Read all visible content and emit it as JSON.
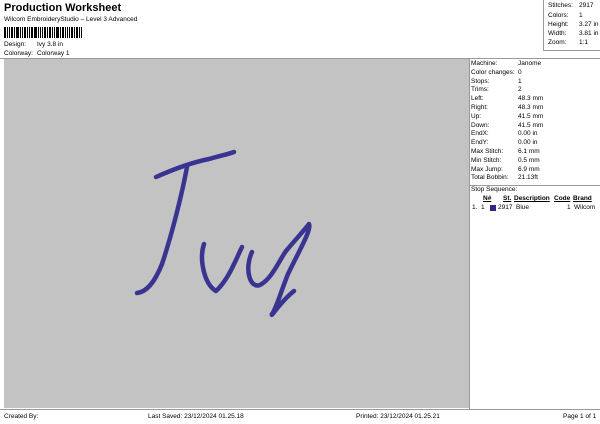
{
  "header": {
    "title": "Production Worksheet",
    "subtitle": "Wilcom EmbroideryStudio – Level 3 Advanced",
    "design_label": "Design:",
    "design_value": "Ivy 3.8 in",
    "colorway_label": "Colorway:",
    "colorway_value": "Colorway 1"
  },
  "stats": [
    {
      "label": "Stitches:",
      "value": "2917"
    },
    {
      "label": "Colors:",
      "value": "1"
    },
    {
      "label": "Height:",
      "value": "3.27 in"
    },
    {
      "label": "Width:",
      "value": "3.81 in"
    },
    {
      "label": "Zoom:",
      "value": "1:1"
    }
  ],
  "details": [
    {
      "label": "Machine:",
      "value": "Janome"
    },
    {
      "label": "Color changes:",
      "value": "0"
    },
    {
      "label": "Stops:",
      "value": "1"
    },
    {
      "label": "Trims:",
      "value": "2"
    },
    {
      "label": "Left:",
      "value": "48.3 mm"
    },
    {
      "label": "Right:",
      "value": "48.3 mm"
    },
    {
      "label": "Up:",
      "value": "41.5 mm"
    },
    {
      "label": "Down:",
      "value": "41.5 mm"
    },
    {
      "label": "EndX:",
      "value": "0.00 in"
    },
    {
      "label": "EndY:",
      "value": "0.00 in"
    },
    {
      "label": "Max Stitch:",
      "value": "6.1 mm"
    },
    {
      "label": "Min Stitch:",
      "value": "0.5 mm"
    },
    {
      "label": "Max Jump:",
      "value": "6.9 mm"
    },
    {
      "label": "Total Bobbin:",
      "value": "21.13ft"
    }
  ],
  "stop_sequence": {
    "title": "Stop Sequence:",
    "headers": {
      "num": "N#",
      "st": "St.",
      "description": "Description",
      "code": "Code",
      "brand": "Brand"
    },
    "rows": [
      {
        "index": "1.",
        "num": "1",
        "st": "2917",
        "description": "Blue",
        "code": "1",
        "brand": "Wilcom",
        "color": "#2c2a7c"
      }
    ]
  },
  "footer": {
    "created": "Created By:",
    "last_saved": "Last Saved: 23/12/2024 01.25.18",
    "printed": "Printed: 23/12/2024 01.25.21",
    "page": "Page 1 of 1"
  },
  "design_thread_color": "#3a3491",
  "canvas_color": "#c3c3c3"
}
